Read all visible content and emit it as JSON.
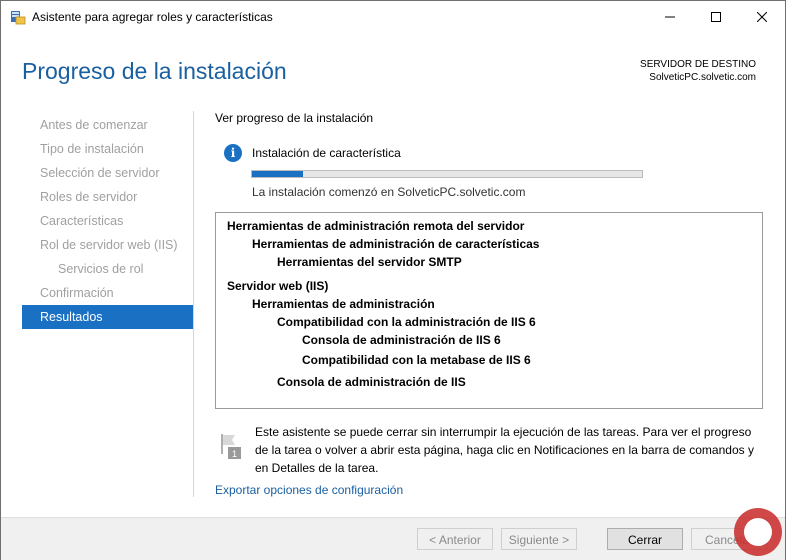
{
  "window": {
    "title": "Asistente para agregar roles y características",
    "controls": {
      "minimize": "minimize-icon",
      "maximize": "maximize-icon",
      "close": "close-icon"
    }
  },
  "header": {
    "title": "Progreso de la instalación",
    "destination_label": "SERVIDOR DE DESTINO",
    "destination_server": "SolveticPC.solvetic.com"
  },
  "nav": {
    "items": [
      {
        "label": "Antes de comenzar",
        "state": "disabled"
      },
      {
        "label": "Tipo de instalación",
        "state": "disabled"
      },
      {
        "label": "Selección de servidor",
        "state": "disabled"
      },
      {
        "label": "Roles de servidor",
        "state": "disabled"
      },
      {
        "label": "Características",
        "state": "disabled"
      },
      {
        "label": "Rol de servidor web (IIS)",
        "state": "disabled"
      },
      {
        "label": "Servicios de rol",
        "state": "disabled"
      },
      {
        "label": "Confirmación",
        "state": "disabled"
      },
      {
        "label": "Resultados",
        "state": "active"
      }
    ]
  },
  "main": {
    "section_title": "Ver progreso de la instalación",
    "status_title": "Instalación de característica",
    "progress_fraction": 0.13,
    "status_sub": "La instalación comenzó en SolveticPC.solvetic.com",
    "results": [
      {
        "label": "Herramientas de administración remota del servidor",
        "level": 0
      },
      {
        "label": "Herramientas de administración de características",
        "level": 1
      },
      {
        "label": "Herramientas del servidor SMTP",
        "level": 2
      },
      {
        "label": "Servidor web (IIS)",
        "level": 0
      },
      {
        "label": "Herramientas de administración",
        "level": 1
      },
      {
        "label": "Compatibilidad con la administración de IIS 6",
        "level": 2
      },
      {
        "label": "Consola de administración de IIS 6",
        "level": 3
      },
      {
        "label": "Compatibilidad con la metabase de IIS 6",
        "level": 3
      },
      {
        "label": "Consola de administración de IIS",
        "level": 2
      }
    ],
    "note": "Este asistente se puede cerrar sin interrumpir la ejecución de las tareas. Para ver el progreso de la tarea o volver a abrir esta página, haga clic en Notificaciones en la barra de comandos y en Detalles de la tarea.",
    "export_link": "Exportar opciones de configuración"
  },
  "footer": {
    "back": "< Anterior",
    "next": "Siguiente >",
    "close": "Cerrar",
    "cancel": "Cancelar"
  },
  "colors": {
    "accent": "#1a71c4",
    "title_blue": "#1a5fa0",
    "disabled_text": "#a0a0a0"
  }
}
